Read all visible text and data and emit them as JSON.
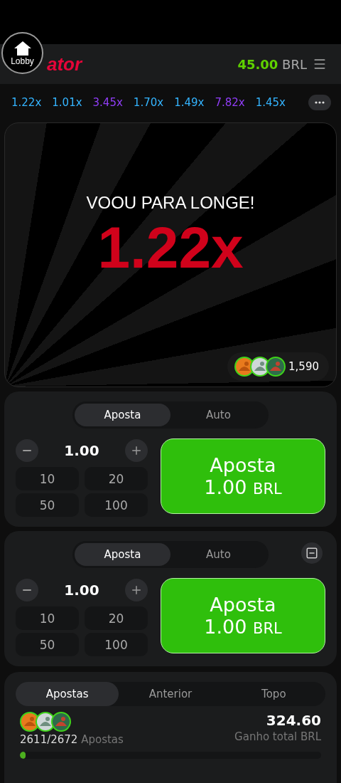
{
  "lobby_button": {
    "label": "Lobby"
  },
  "logo": "ator",
  "balance": {
    "amount": "45.00",
    "currency": "BRL"
  },
  "multipliers": [
    {
      "value": "1.22x",
      "color": "#34b4ff"
    },
    {
      "value": "1.01x",
      "color": "#34b4ff"
    },
    {
      "value": "3.45x",
      "color": "#913ef8"
    },
    {
      "value": "1.70x",
      "color": "#34b4ff"
    },
    {
      "value": "1.49x",
      "color": "#34b4ff"
    },
    {
      "value": "7.82x",
      "color": "#913ef8"
    },
    {
      "value": "1.45x",
      "color": "#34b4ff"
    }
  ],
  "game": {
    "message": "VOOU PARA LONGE!",
    "multiplier": "1.22x",
    "players": "1,590"
  },
  "bet_panels": [
    {
      "tabs": [
        {
          "label": "Aposta",
          "selected": true
        },
        {
          "label": "Auto",
          "selected": false
        }
      ],
      "removable": false,
      "amount": "1.00",
      "quick_amounts": [
        "10",
        "20",
        "50",
        "100"
      ],
      "button": {
        "title": "Aposta",
        "amount": "1.00",
        "currency": "BRL"
      }
    },
    {
      "tabs": [
        {
          "label": "Aposta",
          "selected": true
        },
        {
          "label": "Auto",
          "selected": false
        }
      ],
      "removable": true,
      "amount": "1.00",
      "quick_amounts": [
        "10",
        "20",
        "50",
        "100"
      ],
      "button": {
        "title": "Aposta",
        "amount": "1.00",
        "currency": "BRL"
      }
    }
  ],
  "history": {
    "tabs": [
      {
        "label": "Apostas",
        "selected": true
      },
      {
        "label": "Anterior",
        "selected": false
      },
      {
        "label": "Topo",
        "selected": false
      }
    ],
    "count": "2611/2672",
    "count_label": "Apostas",
    "total": "324.60",
    "total_label": "Ganho total BRL",
    "level": 0.02
  }
}
